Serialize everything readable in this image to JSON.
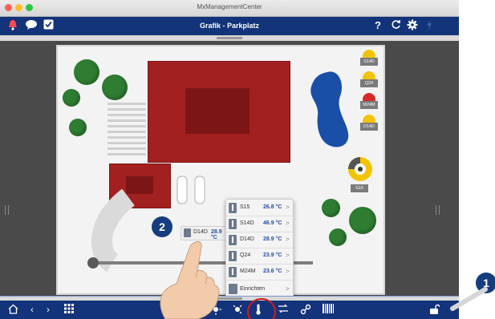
{
  "window": {
    "title": "MxManagementCenter"
  },
  "toolbar": {
    "title": "Grafik - Parkplatz",
    "help_icon": "?"
  },
  "sensors": [
    {
      "label": "S14D",
      "color": "#f2c300"
    },
    {
      "label": "Q24",
      "color": "#f2c300"
    },
    {
      "label": "M24M",
      "color": "#d62a2a"
    },
    {
      "label": "D14D",
      "color": "#f2c300"
    },
    {
      "label": "S15",
      "color": "#f2c300"
    }
  ],
  "tooltip": {
    "name": "D14D",
    "value": "28.9 °C",
    "chevron": ">"
  },
  "popup": {
    "items": [
      {
        "name": "S15",
        "value": "26.8 °C",
        "chevron": ">"
      },
      {
        "name": "S14D",
        "value": "46.9 °C",
        "chevron": ">"
      },
      {
        "name": "D14D",
        "value": "28.9 °C",
        "chevron": ">"
      },
      {
        "name": "Q24",
        "value": "23.9 °C",
        "chevron": ">"
      },
      {
        "name": "M24M",
        "value": "23.6 °C",
        "chevron": ">"
      }
    ],
    "setup": {
      "label": "Einrichten",
      "chevron": ">"
    }
  },
  "callouts": {
    "step1": "1",
    "step2": "2"
  },
  "colors": {
    "bar": "#13337a",
    "building": "#a32020",
    "tree": "#2e7d32",
    "water": "#1a4fa8",
    "highlight": "#d01c1c"
  }
}
